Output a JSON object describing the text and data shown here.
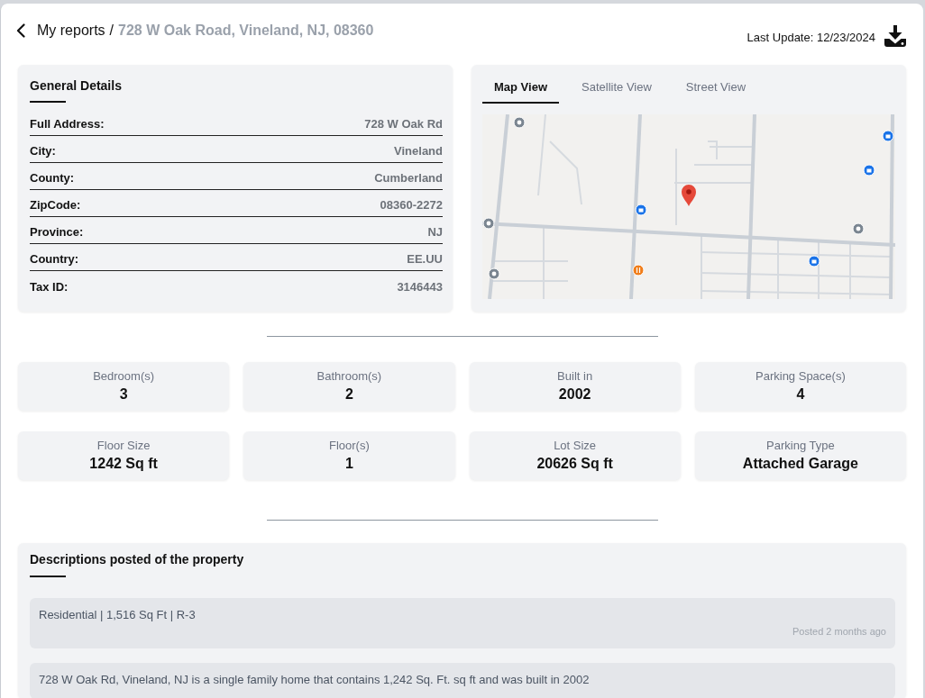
{
  "header": {
    "breadcrumb": [
      {
        "label": "My reports",
        "current": false
      },
      {
        "label": "728 W Oak Road, Vineland, NJ, 08360",
        "current": true
      }
    ],
    "separator": "/",
    "last_update": "Last Update: 12/23/2024"
  },
  "general_details": {
    "title": "General Details",
    "rows": [
      {
        "label": "Full Address:",
        "value": "728 W Oak Rd"
      },
      {
        "label": "City:",
        "value": "Vineland"
      },
      {
        "label": "County:",
        "value": "Cumberland"
      },
      {
        "label": "ZipCode:",
        "value": "08360-2272"
      },
      {
        "label": "Province:",
        "value": "NJ"
      },
      {
        "label": "Country:",
        "value": "EE.UU"
      },
      {
        "label": "Tax ID:",
        "value": "3146443"
      }
    ]
  },
  "map": {
    "tabs": [
      {
        "label": "Map View",
        "selected": true
      },
      {
        "label": "Satellite View",
        "selected": false
      },
      {
        "label": "Street View",
        "selected": false
      }
    ]
  },
  "features": [
    {
      "label": "Bedroom(s)",
      "value": "3"
    },
    {
      "label": "Bathroom(s)",
      "value": "2"
    },
    {
      "label": "Built in",
      "value": "2002"
    },
    {
      "label": "Parking Space(s)",
      "value": "4"
    },
    {
      "label": "Floor Size",
      "value": "1242 Sq ft"
    },
    {
      "label": "Floor(s)",
      "value": "1"
    },
    {
      "label": "Lot Size",
      "value": "20626 Sq ft"
    },
    {
      "label": "Parking Type",
      "value": "Attached Garage"
    }
  ],
  "descriptions": {
    "title": "Descriptions posted of the property",
    "posts": [
      {
        "text": "Residential | 1,516 Sq Ft | R-3",
        "posted": "Posted 2 months ago"
      },
      {
        "text": "728 W Oak Rd, Vineland, NJ is a single family home that contains 1,242 Sq. Ft. sq ft and was built in 2002"
      }
    ]
  }
}
